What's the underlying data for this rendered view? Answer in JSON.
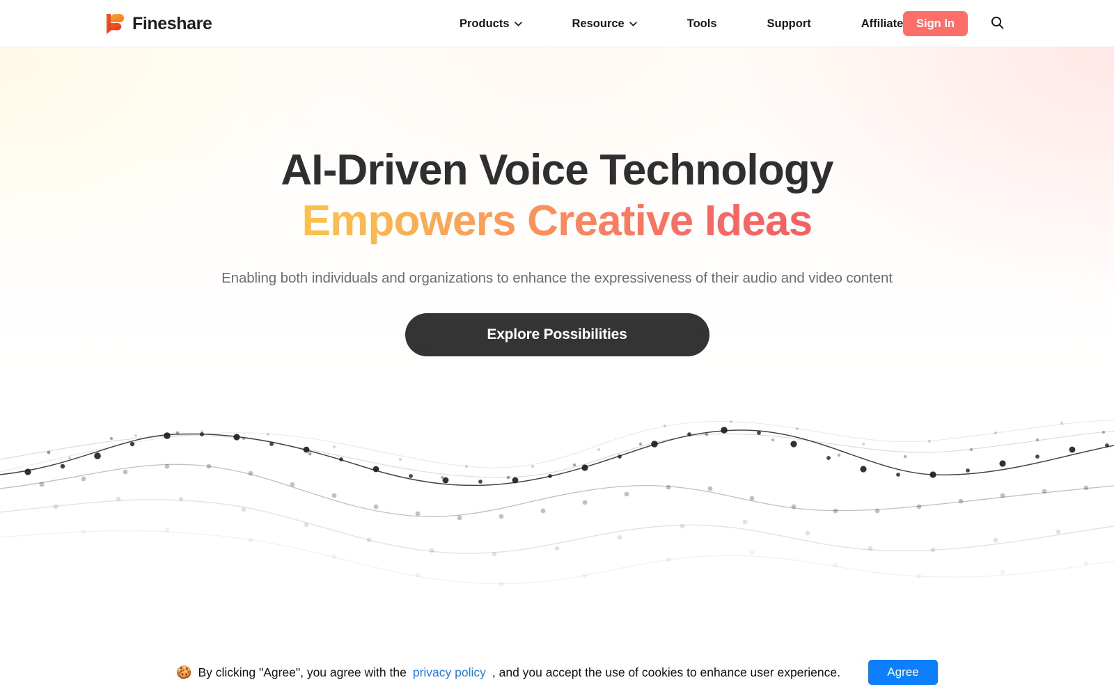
{
  "brand": {
    "name": "Fineshare",
    "logo_icon": "fineshare-f-logo-icon",
    "accent_orange": "#f7861e",
    "accent_red": "#ee3d23"
  },
  "nav": {
    "items": [
      {
        "label": "Products",
        "has_dropdown": true,
        "icon": "chevron-down-icon"
      },
      {
        "label": "Resource",
        "has_dropdown": true,
        "icon": "chevron-down-icon"
      },
      {
        "label": "Tools",
        "has_dropdown": false,
        "icon": ""
      },
      {
        "label": "Support",
        "has_dropdown": false,
        "icon": ""
      },
      {
        "label": "Affiliate",
        "has_dropdown": false,
        "icon": ""
      }
    ],
    "sign_in_label": "Sign In",
    "sign_in_color": "#fc6f69",
    "search_icon": "search-icon"
  },
  "hero": {
    "headline_line1": "AI-Driven Voice Technology",
    "headline_line2": "Empowers Creative Ideas",
    "headline_line1_color": "#2f2f31",
    "headline_gradient_start": "#fbc04a",
    "headline_gradient_end": "#f45f63",
    "subtitle": "Enabling both individuals and organizations to enhance the expressiveness of their audio and video content",
    "subtitle_color": "#6c6c72",
    "cta_label": "Explore Possibilities",
    "cta_color": "#343434"
  },
  "decoration": {
    "graphic": "dotted-wave-lines",
    "line_count": 5
  },
  "cookie_banner": {
    "icon": "cookie-icon",
    "icon_glyph": "🍪",
    "text_before_link": "By clicking \"Agree\", you agree with the",
    "link_label": "privacy policy",
    "link_color": "#1a7bf0",
    "text_after_link": ", and you accept the use of cookies to enhance user experience.",
    "agree_label": "Agree",
    "agree_color": "#0d7ffb"
  }
}
